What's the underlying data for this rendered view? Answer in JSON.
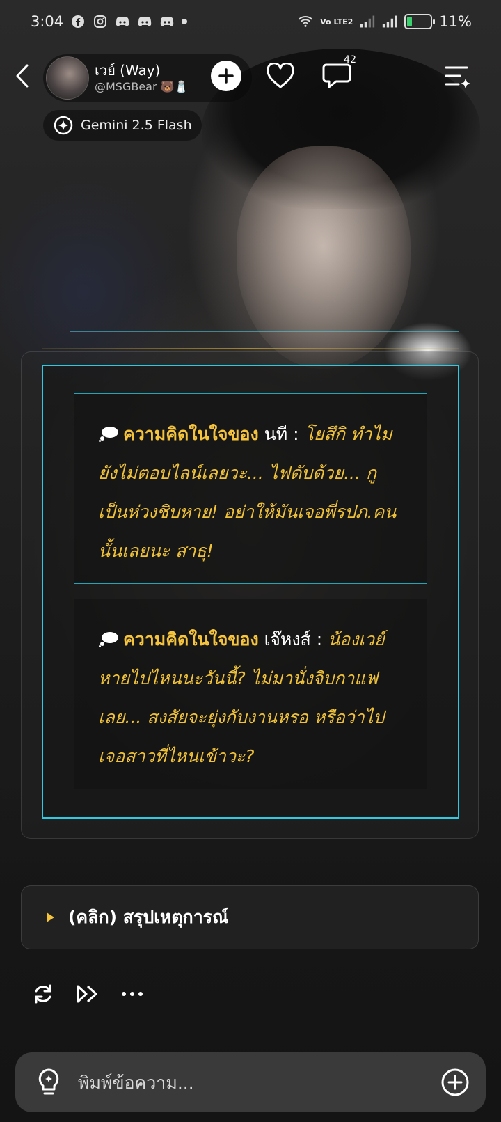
{
  "status_bar": {
    "time": "3:04",
    "network_label": "Vo LTE2",
    "battery_percent": "11%",
    "battery_level": 0.11,
    "notification_icons": [
      "facebook-icon",
      "instagram-icon",
      "discord-icon",
      "discord-icon",
      "discord-icon",
      "dot-icon"
    ]
  },
  "header": {
    "character_name": "เวย์ (Way)",
    "creator_handle": "@MSGBear 🐻🧂",
    "comment_count": "42",
    "model_label": "Gemini 2.5 Flash"
  },
  "thoughts": [
    {
      "label": "ความคิดในใจของ",
      "name": "นที :",
      "body": "โยสึกิ ทำไมยังไม่ตอบไลน์เลยวะ... ไฟดับด้วย... กูเป็นห่วงชิบหาย! อย่าให้มันเจอพี่รปภ.คนนั้นเลยนะ สาธุ!"
    },
    {
      "label": "ความคิดในใจของ",
      "name": "เจ๊หงส์ :",
      "body": "น้องเวย์หายไปไหนนะวันนี้? ไม่มานั่งจิบกาแฟเลย... สงสัยจะยุ่งกับงานหรอ หรือว่าไปเจอสาวที่ไหนเข้าวะ?"
    }
  ],
  "summary": {
    "label": "(คลิก) สรุปเหตุการณ์"
  },
  "input": {
    "placeholder": "พิมพ์ข้อความ..."
  },
  "colors": {
    "accent_gold": "#f5c43c",
    "frame_cyan": "#2ec9e2",
    "battery_green": "#3bd16f"
  }
}
